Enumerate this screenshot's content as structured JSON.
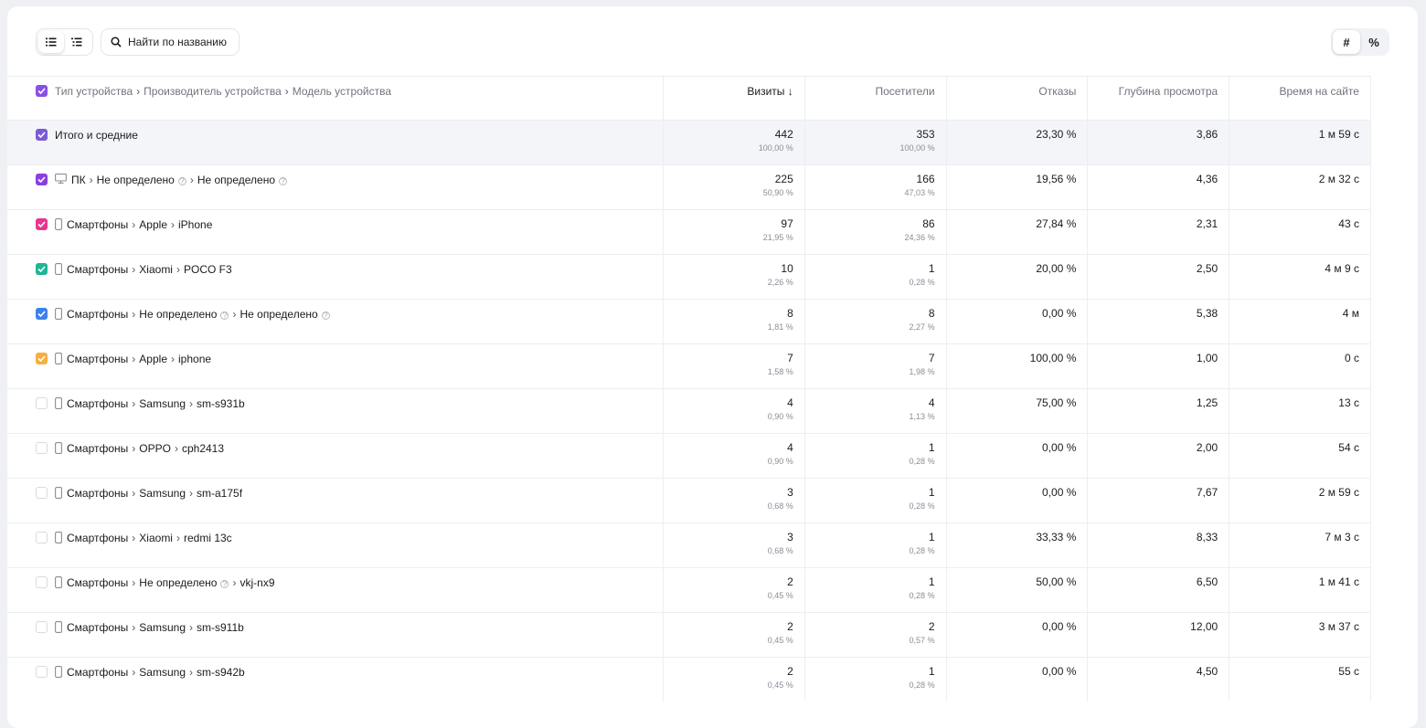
{
  "toolbar": {
    "search_label": "Найти по названию",
    "mode_count": "#",
    "mode_percent": "%"
  },
  "header": {
    "dim_parts": [
      "Тип устройства",
      "Производитель устройства",
      "Модель устройства"
    ],
    "visits": "Визиты",
    "visits_sort": "↓",
    "visitors": "Посетители",
    "bounces": "Отказы",
    "depth": "Глубина просмотра",
    "time": "Время на сайте",
    "checkbox_color": "#8a4fe6"
  },
  "total": {
    "label": "Итого и средние",
    "visits": "442",
    "visits_pct": "100,00 %",
    "visitors": "353",
    "visitors_pct": "100,00 %",
    "bounces": "23,30 %",
    "depth": "3,86",
    "time": "1 м 59 с",
    "checkbox_color": "#7b5cd6"
  },
  "rows": [
    {
      "device": "ПК",
      "icon": "desktop-icon",
      "maker": "Не определено",
      "maker_hint": true,
      "model": "Не определено",
      "model_hint": true,
      "visits": "225",
      "visits_pct": "50,90 %",
      "visitors": "166",
      "visitors_pct": "47,03 %",
      "bounces": "19,56 %",
      "depth": "4,36",
      "time": "2 м 32 с",
      "checked": true,
      "color": "#8a3fe0"
    },
    {
      "device": "Смартфоны",
      "icon": "smartphone-icon",
      "maker": "Apple",
      "maker_hint": false,
      "model": "iPhone",
      "model_hint": false,
      "visits": "97",
      "visits_pct": "21,95 %",
      "visitors": "86",
      "visitors_pct": "24,36 %",
      "bounces": "27,84 %",
      "depth": "2,31",
      "time": "43 с",
      "checked": true,
      "color": "#e8368f"
    },
    {
      "device": "Смартфоны",
      "icon": "smartphone-icon",
      "maker": "Xiaomi",
      "maker_hint": false,
      "model": "POCO F3",
      "model_hint": false,
      "visits": "10",
      "visits_pct": "2,26 %",
      "visitors": "1",
      "visitors_pct": "0,28 %",
      "bounces": "20,00 %",
      "depth": "2,50",
      "time": "4 м 9 с",
      "checked": true,
      "color": "#1fb597"
    },
    {
      "device": "Смартфоны",
      "icon": "smartphone-icon",
      "maker": "Не определено",
      "maker_hint": true,
      "model": "Не определено",
      "model_hint": true,
      "visits": "8",
      "visits_pct": "1,81 %",
      "visitors": "8",
      "visitors_pct": "2,27 %",
      "bounces": "0,00 %",
      "depth": "5,38",
      "time": "4 м",
      "checked": true,
      "color": "#3b82f0"
    },
    {
      "device": "Смартфоны",
      "icon": "smartphone-icon",
      "maker": "Apple",
      "maker_hint": false,
      "model": "iphone",
      "model_hint": false,
      "visits": "7",
      "visits_pct": "1,58 %",
      "visitors": "7",
      "visitors_pct": "1,98 %",
      "bounces": "100,00 %",
      "depth": "1,00",
      "time": "0 с",
      "checked": true,
      "color": "#f5b041"
    },
    {
      "device": "Смартфоны",
      "icon": "smartphone-icon",
      "maker": "Samsung",
      "maker_hint": false,
      "model": "sm-s931b",
      "model_hint": false,
      "visits": "4",
      "visits_pct": "0,90 %",
      "visitors": "4",
      "visitors_pct": "1,13 %",
      "bounces": "75,00 %",
      "depth": "1,25",
      "time": "13 с",
      "checked": false,
      "color": ""
    },
    {
      "device": "Смартфоны",
      "icon": "smartphone-icon",
      "maker": "OPPO",
      "maker_hint": false,
      "model": "cph2413",
      "model_hint": false,
      "visits": "4",
      "visits_pct": "0,90 %",
      "visitors": "1",
      "visitors_pct": "0,28 %",
      "bounces": "0,00 %",
      "depth": "2,00",
      "time": "54 с",
      "checked": false,
      "color": ""
    },
    {
      "device": "Смартфоны",
      "icon": "smartphone-icon",
      "maker": "Samsung",
      "maker_hint": false,
      "model": "sm-a175f",
      "model_hint": false,
      "visits": "3",
      "visits_pct": "0,68 %",
      "visitors": "1",
      "visitors_pct": "0,28 %",
      "bounces": "0,00 %",
      "depth": "7,67",
      "time": "2 м 59 с",
      "checked": false,
      "color": ""
    },
    {
      "device": "Смартфоны",
      "icon": "smartphone-icon",
      "maker": "Xiaomi",
      "maker_hint": false,
      "model": "redmi 13c",
      "model_hint": false,
      "visits": "3",
      "visits_pct": "0,68 %",
      "visitors": "1",
      "visitors_pct": "0,28 %",
      "bounces": "33,33 %",
      "depth": "8,33",
      "time": "7 м 3 с",
      "checked": false,
      "color": ""
    },
    {
      "device": "Смартфоны",
      "icon": "smartphone-icon",
      "maker": "Не определено",
      "maker_hint": true,
      "model": "vkj-nx9",
      "model_hint": false,
      "visits": "2",
      "visits_pct": "0,45 %",
      "visitors": "1",
      "visitors_pct": "0,28 %",
      "bounces": "50,00 %",
      "depth": "6,50",
      "time": "1 м 41 с",
      "checked": false,
      "color": ""
    },
    {
      "device": "Смартфоны",
      "icon": "smartphone-icon",
      "maker": "Samsung",
      "maker_hint": false,
      "model": "sm-s911b",
      "model_hint": false,
      "visits": "2",
      "visits_pct": "0,45 %",
      "visitors": "2",
      "visitors_pct": "0,57 %",
      "bounces": "0,00 %",
      "depth": "12,00",
      "time": "3 м 37 с",
      "checked": false,
      "color": ""
    },
    {
      "device": "Смартфоны",
      "icon": "smartphone-icon",
      "maker": "Samsung",
      "maker_hint": false,
      "model": "sm-s942b",
      "model_hint": false,
      "visits": "2",
      "visits_pct": "0,45 %",
      "visitors": "1",
      "visitors_pct": "0,28 %",
      "bounces": "0,00 %",
      "depth": "4,50",
      "time": "55 с",
      "checked": false,
      "color": ""
    }
  ]
}
